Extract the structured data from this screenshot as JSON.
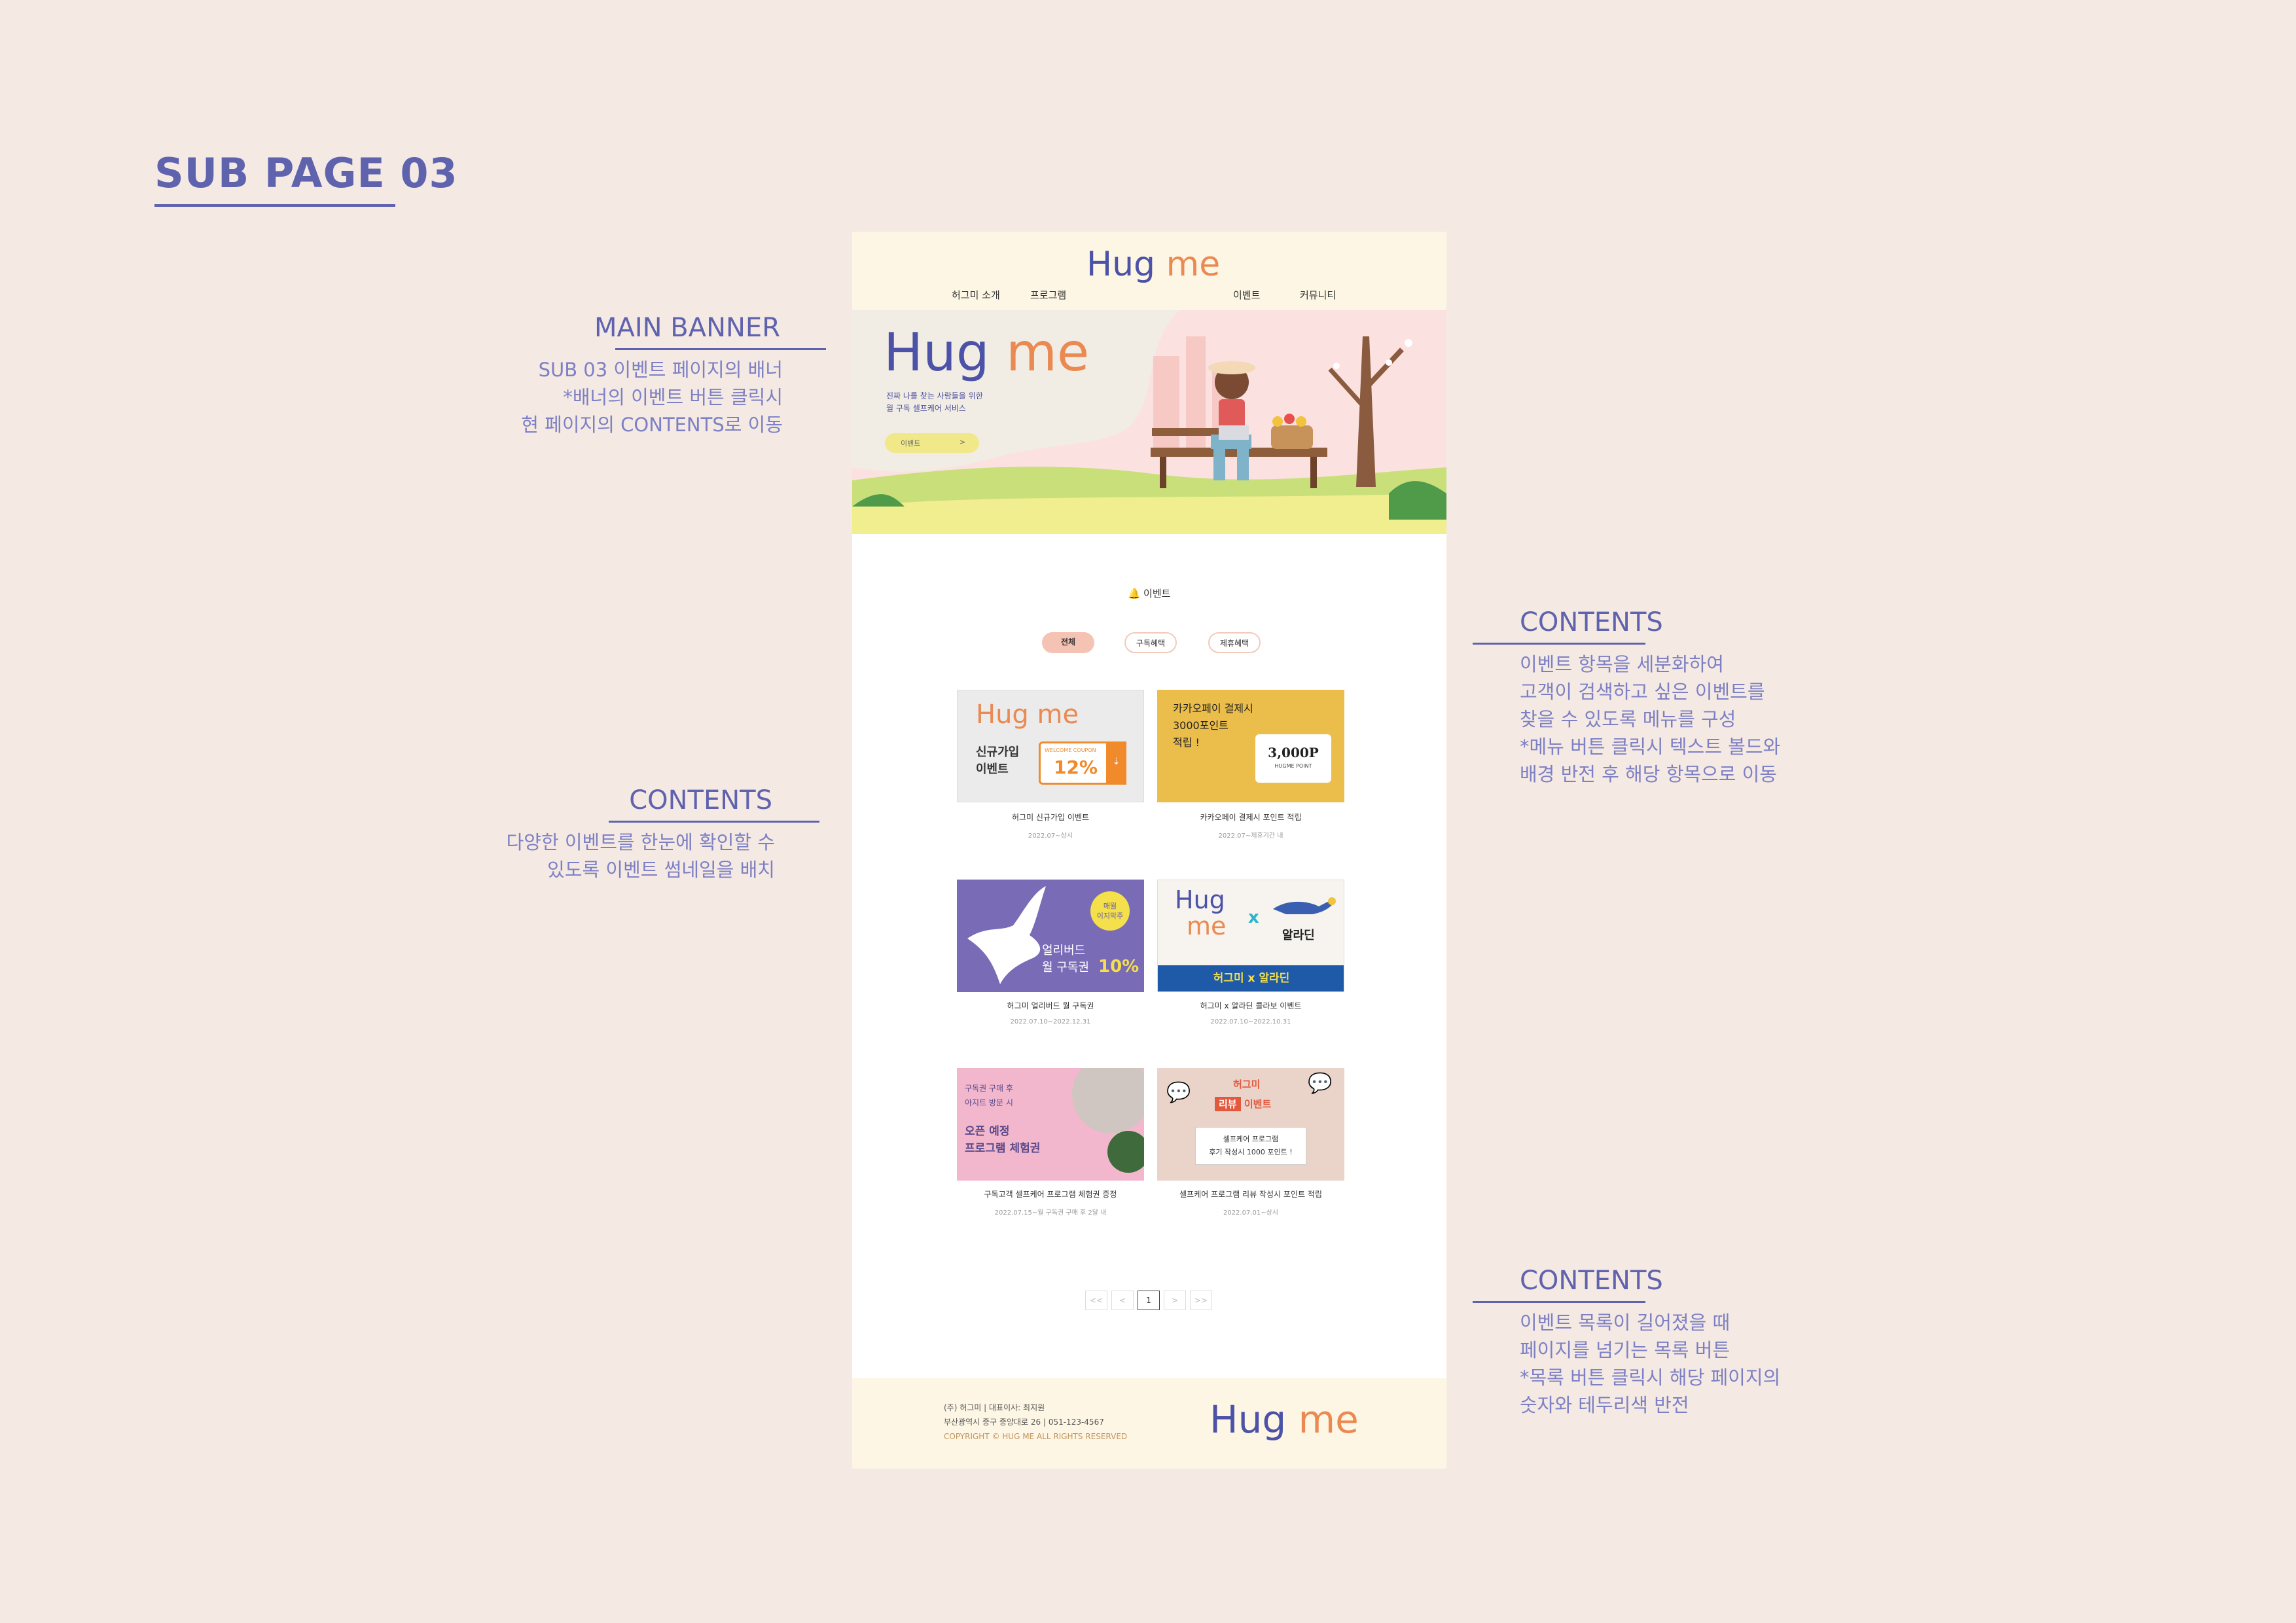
{
  "page": {
    "title": "SUB PAGE 03"
  },
  "annotations": {
    "main_banner": {
      "head": "MAIN BANNER",
      "lines": [
        "SUB 03 이벤트 페이지의 배너",
        "*배너의 이벤트 버튼 클릭시",
        "현 페이지의 CONTENTS로 이동"
      ]
    },
    "contents_left": {
      "head": "CONTENTS",
      "lines": [
        "다양한 이벤트를 한눈에 확인할 수",
        "있도록 이벤트 썸네일을 배치"
      ]
    },
    "contents_right_top": {
      "head": "CONTENTS",
      "lines": [
        "이벤트 항목을 세분화하여",
        "고객이 검색하고 싶은 이벤트를",
        "찾을 수 있도록 메뉴를 구성",
        "*메뉴 버튼 클릭시 텍스트 볼드와",
        "배경 반전 후 해당 항목으로 이동"
      ]
    },
    "contents_right_bottom": {
      "head": "CONTENTS",
      "lines": [
        "이벤트 목록이 길어졌을 때",
        "페이지를 넘기는 목록 버튼",
        "*목록 버튼 클릭시 해당 페이지의",
        "숫자와 테두리색 반전"
      ]
    }
  },
  "site": {
    "logo": {
      "hug": "Hug",
      "me": "me"
    },
    "nav": [
      "허그미 소개",
      "프로그램",
      "이벤트",
      "커뮤니티"
    ],
    "banner": {
      "line1": "진짜 나를 찾는 사람들을 위한",
      "line2": "월 구독 셀프케어 서비스",
      "button": "이벤트",
      "button_arrow": ">"
    },
    "section_title": "이벤트",
    "tabs": [
      "전체",
      "구독혜택",
      "제휴혜택"
    ],
    "cards": [
      {
        "title": "허그미 신규가입 이벤트",
        "date": "2022.07~상시",
        "thumb": {
          "line1": "신규가입",
          "line2": "이벤트",
          "coupon_label": "WELCOME COUPON",
          "coupon_value": "12%"
        }
      },
      {
        "title": "카카오페이 결제시 포인트 적립",
        "date": "2022.07~제휴기간 내",
        "thumb": {
          "line1": "카카오페이 결제시",
          "line2": "3000포인트",
          "line3": "적립 !",
          "point": "3,000P",
          "point_label": "HUGME POINT"
        }
      },
      {
        "title": "허그미 얼리버드 월 구독권",
        "date": "2022.07.10~2022.12.31",
        "thumb": {
          "badge_line1": "매월",
          "badge_line2": "이지막주",
          "line1": "얼리버드",
          "line2": "월 구독권",
          "pct": "10%"
        }
      },
      {
        "title": "허그미 x 알라딘 콜라보 이벤트",
        "date": "2022.07.10~2022.10.31",
        "thumb": {
          "x": "x",
          "partner": "알라딘",
          "bar": "허그미 x 알라딘"
        }
      },
      {
        "title": "구독고객 셀프케어 프로그램 체험권 증정",
        "date": "2022.07.15~월 구독권 구매 후 2달 내",
        "thumb": {
          "line1": "구독권 구매 후",
          "line2": "아지트 방문 시",
          "line3": "오픈 예정",
          "line4": "프로그램 체험권"
        }
      },
      {
        "title": "셀프케어 프로그램 리뷰 작성시 포인트 적립",
        "date": "2022.07.01~상시",
        "thumb": {
          "line1": "허그미",
          "tag": "리뷰",
          "line2": "이벤트",
          "box1": "셀프케어 프로그램",
          "box2": "후기 작성시 1000 포인트 !"
        }
      }
    ],
    "pagination": [
      "<<",
      "<",
      "1",
      ">",
      ">>"
    ],
    "footer": {
      "line1": "(주) 허그미   |   대표이사: 최지원",
      "line2": "부산광역시 중구 중앙대로 26   |   051-123-4567",
      "line3": "COPYRIGHT © HUG ME ALL RIGHTS RESERVED"
    }
  },
  "colors": {
    "accent": "#5f63ae",
    "background": "#f4e9e3",
    "header_bg": "#fdf6e4",
    "tab_active": "#f5c3b4",
    "logo_orange": "#ea8a52"
  }
}
